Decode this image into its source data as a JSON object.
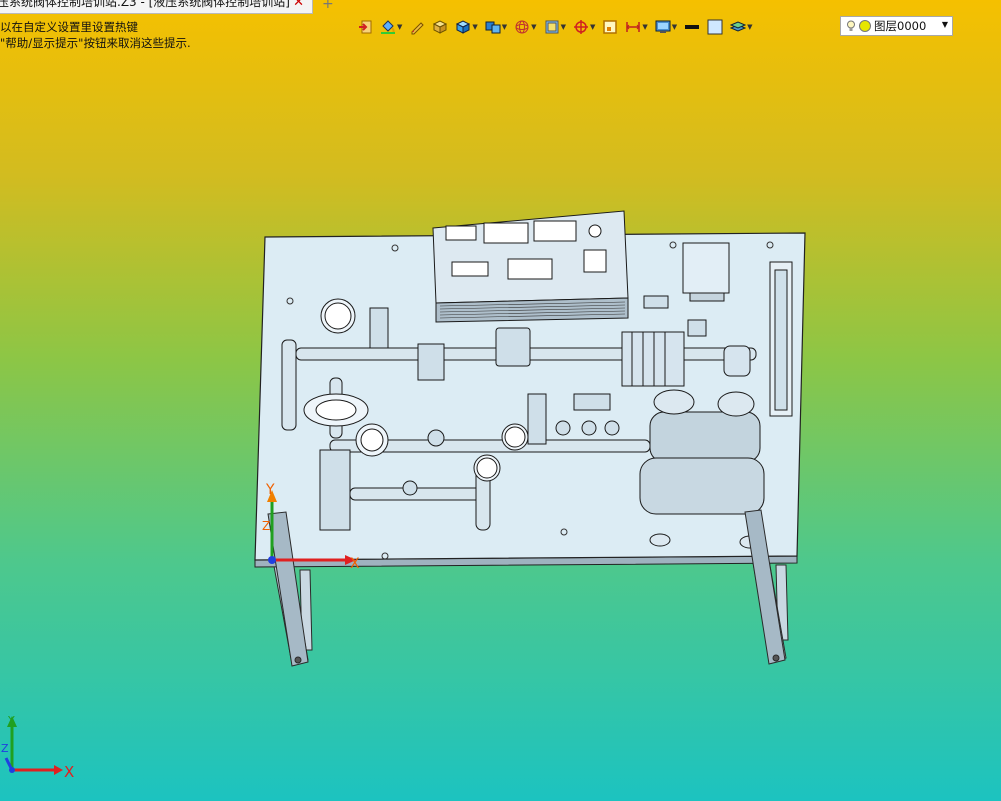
{
  "tab": {
    "title": "压系统阀体控制培训站.Z3 - [液压系统阀体控制培训站]",
    "close_symbol": "✕",
    "add_symbol": "+"
  },
  "hints": {
    "line1": "以在自定义设置里设置热键",
    "line2": "\"帮助/显示提示\"按钮来取消这些提示."
  },
  "toolbar": {
    "buttons": [
      {
        "icon": "exit-icon"
      },
      {
        "icon": "paint-bucket-icon"
      },
      {
        "icon": "pencil-icon"
      },
      {
        "icon": "box-solid-icon"
      },
      {
        "icon": "cube-blue-icon"
      },
      {
        "icon": "cube-multi-icon"
      },
      {
        "icon": "sphere-wire-icon"
      },
      {
        "icon": "frame-icon"
      },
      {
        "icon": "crosshair-icon"
      },
      {
        "icon": "view-box-icon"
      },
      {
        "icon": "dimension-icon"
      },
      {
        "icon": "display-icon"
      },
      {
        "icon": "line-style-icon"
      },
      {
        "icon": "color-square-icon"
      },
      {
        "icon": "layer-stack-icon"
      }
    ]
  },
  "layer": {
    "value": "图层0000"
  },
  "viewport": {
    "axes": {
      "x": "X",
      "y": "Y",
      "z": "Z"
    },
    "colors": {
      "x_axis": "#e02020",
      "y_axis": "#20a020",
      "z_axis": "#2040e0",
      "model_face": "#dcecf4",
      "model_edge": "#1a1a1a"
    }
  }
}
